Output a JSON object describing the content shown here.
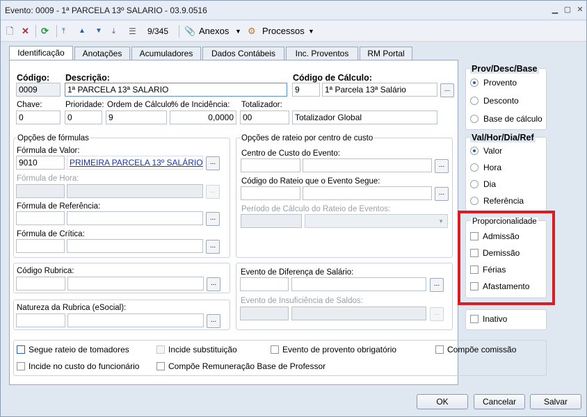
{
  "window": {
    "title": "Evento: 0009 - 1ª PARCELA 13º SALARIO - 03.9.0516"
  },
  "toolbar": {
    "counter": "9/345",
    "attachments": "Anexos",
    "processes": "Processos"
  },
  "tabs": [
    "Identificação",
    "Anotações",
    "Acumuladores",
    "Dados Contábeis",
    "Inc. Proventos",
    "RM Portal"
  ],
  "ident": {
    "codigo_label": "Código:",
    "codigo": "0009",
    "descricao_label": "Descrição:",
    "descricao": "1ª PARCELA 13ª SALARIO",
    "calc_label": "Código de Cálculo:",
    "calc_code": "9",
    "calc_desc": "1ª Parcela 13ª Salário",
    "chave_label": "Chave:",
    "chave": "0",
    "prioridade_label": "Prioridade:",
    "prioridade": "0",
    "ordem_label": "Ordem de Cálculo:",
    "ordem": "9",
    "incid_label": "% de Incidência:",
    "incid": "0,0000",
    "totalizador_label": "Totalizador:",
    "totalizador_code": "00",
    "totalizador_desc": "Totalizador Global"
  },
  "formulas": {
    "title": "Opções de fórmulas",
    "valor_label": "Fórmula de Valor:",
    "valor_code": "9010",
    "valor_desc": "PRIMEIRA PARCELA 13º SALÁRIO",
    "hora_label": "Fórmula de Hora:",
    "ref_label": "Fórmula de Referência:",
    "critica_label": "Fórmula de Crítica:"
  },
  "rateio": {
    "title": "Opções de rateio por centro de custo",
    "centro_label": "Centro de Custo do Evento:",
    "codigo_label": "Código do Rateio que o Evento Segue:",
    "periodo_label": "Período de Cálculo do Rateio de Eventos:"
  },
  "rubrica": {
    "label": "Código Rubrica:"
  },
  "natureza": {
    "label": "Natureza da Rubrica (eSocial):"
  },
  "diferenca": {
    "label": "Evento de Diferença de Salário:"
  },
  "insuficiencia": {
    "label": "Evento de Insuficiência de Saldos:"
  },
  "checks": {
    "segue_rateio": "Segue rateio de tomadores",
    "incide_subst": "Incide substituição",
    "evento_obrig": "Evento de provento obrigatório",
    "compoe_comissao": "Compõe comissão",
    "incide_custo": "Incide no custo do funcionário",
    "compoe_remun": "Compõe Remuneração Base de Professor"
  },
  "prov": {
    "title": "Prov/Desc/Base",
    "options": [
      "Provento",
      "Desconto",
      "Base de cálculo"
    ],
    "selected": "Provento"
  },
  "valhor": {
    "title": "Val/Hor/Dia/Ref",
    "options": [
      "Valor",
      "Hora",
      "Dia",
      "Referência"
    ],
    "selected": "Valor"
  },
  "proporcionalidade": {
    "title": "Proporcionalidade",
    "options": [
      "Admissão",
      "Demissão",
      "Férias",
      "Afastamento"
    ]
  },
  "inativo": "Inativo",
  "buttons": {
    "ok": "OK",
    "cancelar": "Cancelar",
    "salvar": "Salvar"
  },
  "colors": {
    "highlight": "#e01a22",
    "link": "#1a35b0",
    "accent": "#2c5ea8"
  }
}
